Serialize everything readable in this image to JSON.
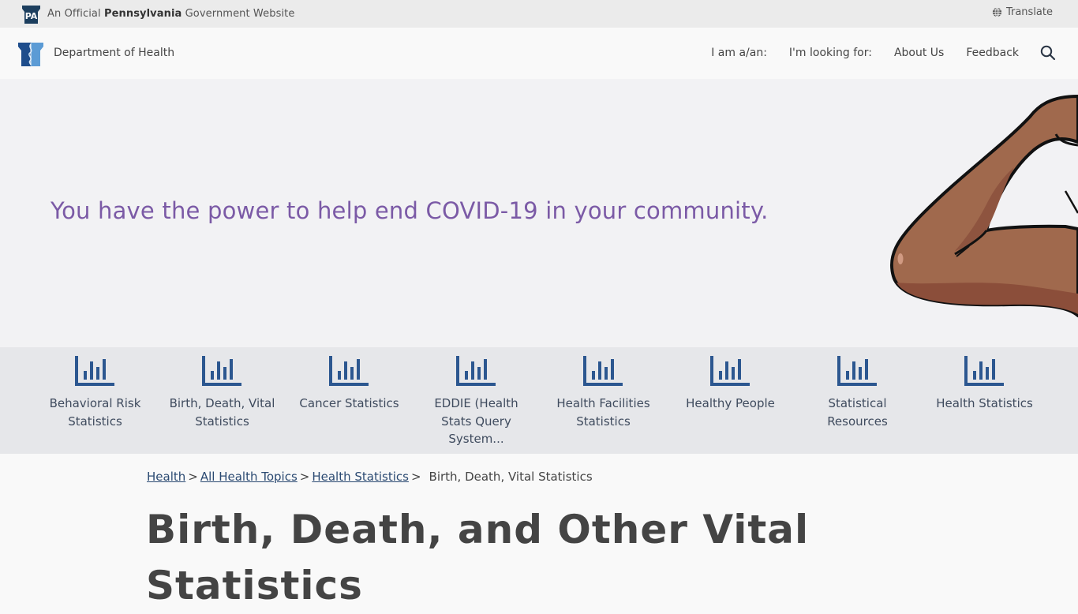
{
  "official_bar": {
    "badge_text": "PA",
    "prefix": "An Official",
    "state": "Pennsylvania",
    "suffix": "Government Website",
    "translate_label": "Translate"
  },
  "header": {
    "department": "Department of Health",
    "nav": [
      {
        "label": "I am a/an:"
      },
      {
        "label": "I'm looking for:"
      },
      {
        "label": "About Us"
      },
      {
        "label": "Feedback"
      }
    ]
  },
  "hero": {
    "message": "You have the power to help end COVID-19 in your community."
  },
  "stats_links": [
    {
      "label": "Behavioral Risk Statistics",
      "icon": "bar-chart-icon"
    },
    {
      "label": "Birth, Death, Vital Statistics",
      "icon": "bar-chart-icon"
    },
    {
      "label": "Cancer Statistics",
      "icon": "bar-chart-icon"
    },
    {
      "label": "EDDIE (Health Stats Query System...",
      "icon": "bar-chart-icon"
    },
    {
      "label": "Health Facilities Statistics",
      "icon": "bar-chart-icon"
    },
    {
      "label": "Healthy People",
      "icon": "bar-chart-icon"
    },
    {
      "label": "Statistical Resources",
      "icon": "bar-chart-icon"
    },
    {
      "label": "Health Statistics",
      "icon": "bar-chart-icon"
    }
  ],
  "breadcrumb": {
    "links": [
      {
        "label": "Health"
      },
      {
        "label": "All Health Topics"
      },
      {
        "label": "Health Statistics"
      }
    ],
    "separator": ">",
    "current": "Birth, Death, Vital Statistics"
  },
  "page": {
    "title": "Birth, Death, and Other Vital Statistics"
  },
  "colors": {
    "hero_text": "#7b5aa6",
    "icon_blue": "#2c5790",
    "link_blue": "#2b4a72",
    "strip_bg": "#e6e7ea"
  }
}
